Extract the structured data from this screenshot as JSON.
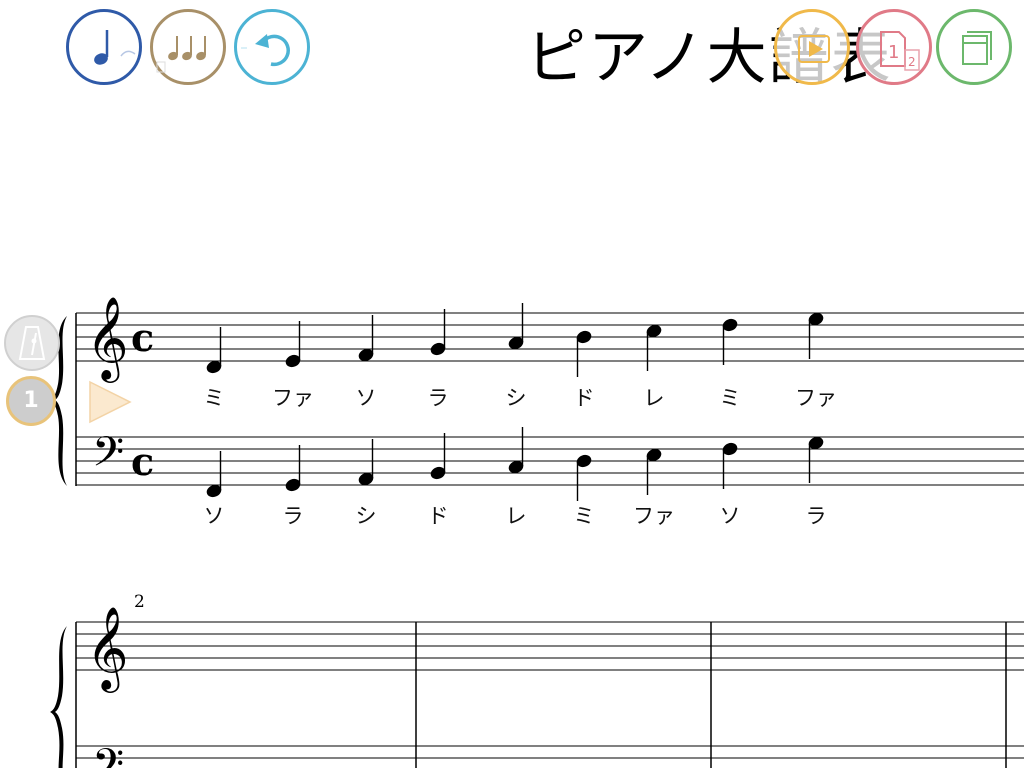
{
  "title": "ピアノ大譜表",
  "toolbar": {
    "left": [
      {
        "name": "note-input-button",
        "icon": "quarter-note-icon",
        "color": "#2f5aa8"
      },
      {
        "name": "rhythm-button",
        "icon": "three-notes-icon",
        "color": "#a89068"
      },
      {
        "name": "undo-button",
        "icon": "undo-arrow-icon",
        "color": "#4cb3d4"
      }
    ],
    "right": [
      {
        "name": "play-button",
        "icon": "play-icon",
        "color": "#f0b94a"
      },
      {
        "name": "page-view-button",
        "icon": "pages-icon",
        "color": "#e07a87"
      },
      {
        "name": "score-book-button",
        "icon": "book-icon",
        "color": "#6cb86c"
      }
    ]
  },
  "side": {
    "metronome_icon": "metronome-icon",
    "measure_badge": "1",
    "play_marker_icon": "play-marker-icon"
  },
  "score": {
    "system1": {
      "time_signature": "c",
      "treble_notes": [
        {
          "step": -1,
          "lyric": "ミ"
        },
        {
          "step": 0,
          "lyric": "ファ"
        },
        {
          "step": 1,
          "lyric": "ソ"
        },
        {
          "step": 2,
          "lyric": "ラ"
        },
        {
          "step": 3,
          "lyric": "シ"
        },
        {
          "step": 4,
          "lyric": "ド"
        },
        {
          "step": 5,
          "lyric": "レ"
        },
        {
          "step": 6,
          "lyric": "ミ"
        },
        {
          "step": 7,
          "lyric": "ファ"
        }
      ],
      "bass_notes": [
        {
          "step": -1,
          "lyric": "ソ"
        },
        {
          "step": 0,
          "lyric": "ラ"
        },
        {
          "step": 1,
          "lyric": "シ"
        },
        {
          "step": 2,
          "lyric": "ド"
        },
        {
          "step": 3,
          "lyric": "レ"
        },
        {
          "step": 4,
          "lyric": "ミ"
        },
        {
          "step": 5,
          "lyric": "ファ"
        },
        {
          "step": 6,
          "lyric": "ソ"
        },
        {
          "step": 7,
          "lyric": "ラ"
        }
      ]
    },
    "system2": {
      "measure_number": "2"
    }
  }
}
